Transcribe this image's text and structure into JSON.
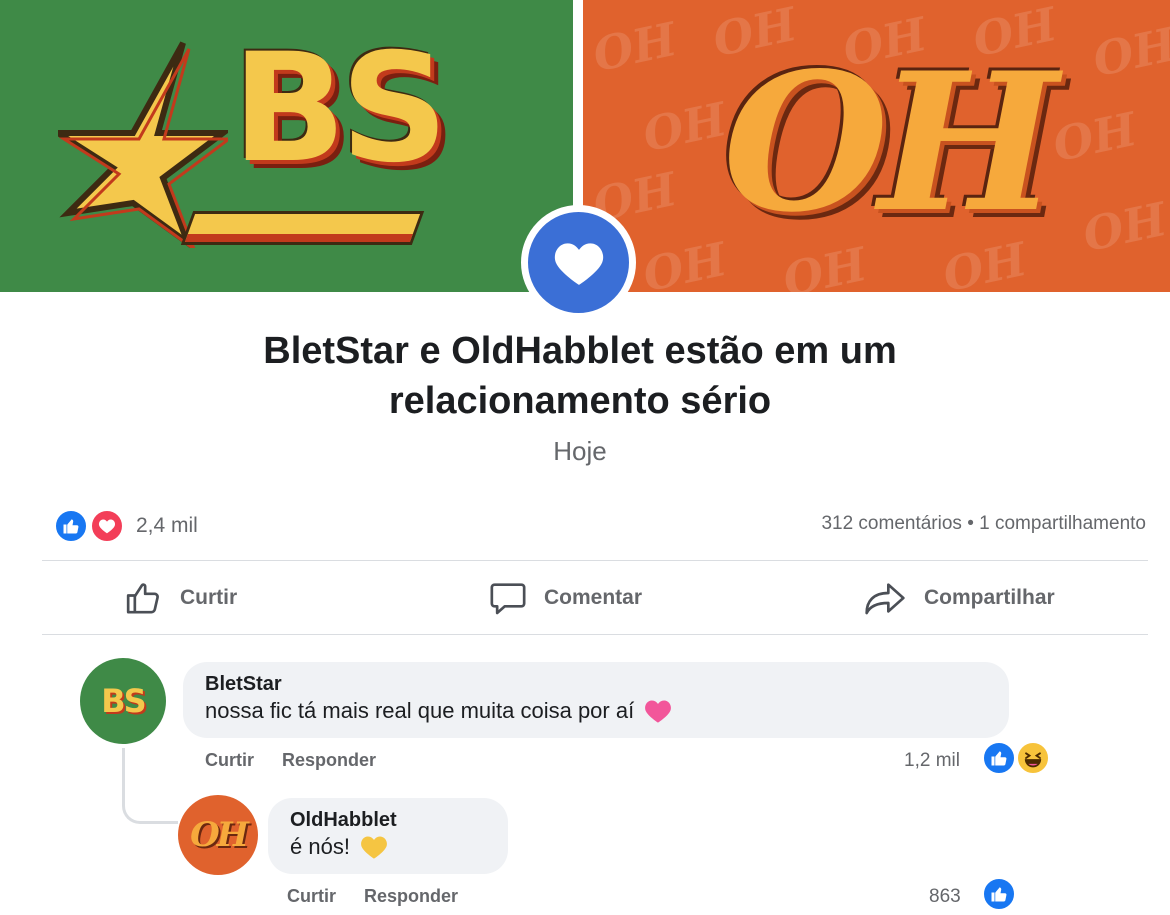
{
  "banner": {
    "left_logo_text": "BS",
    "right_logo_text": "OH",
    "left_bg_color": "#3f8a47",
    "right_bg_color": "#e0622d",
    "badge_icon": "heart-icon",
    "badge_color": "#3b6fd6"
  },
  "post": {
    "headline_line1": "BletStar e OldHabblet estão em um",
    "headline_line2": "relacionamento sério",
    "date": "Hoje"
  },
  "stats": {
    "reaction_icons": [
      "like-icon",
      "love-icon"
    ],
    "reaction_count": "2,4 mil",
    "comments_shares": "312 comentários • 1 compartilhamento"
  },
  "actions": {
    "like": "Curtir",
    "comment": "Comentar",
    "share": "Compartilhar"
  },
  "comments": [
    {
      "author": "BletStar",
      "avatar_text": "BS",
      "text": "nossa fic tá mais real que muita coisa por aí",
      "emoji": "pink-heart-icon",
      "like_label": "Curtir",
      "reply_label": "Responder",
      "reaction_count": "1,2 mil",
      "reactions": [
        "like-icon",
        "haha-icon"
      ]
    },
    {
      "author": "OldHabblet",
      "avatar_text": "OH",
      "text": "é nós!",
      "emoji": "yellow-heart-icon",
      "like_label": "Curtir",
      "reply_label": "Responder",
      "reaction_count": "863",
      "reactions": [
        "like-icon"
      ]
    }
  ]
}
